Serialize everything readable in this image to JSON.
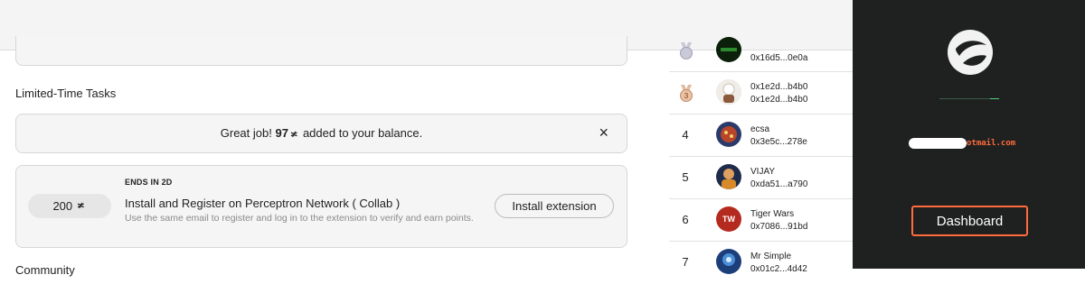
{
  "section": {
    "title": "Limited-Time Tasks",
    "next_title": "Community"
  },
  "toast": {
    "prefix": "Great job!",
    "amount": "97",
    "coin": "≭",
    "suffix": "added to your balance.",
    "close": "×"
  },
  "task": {
    "ends": "ENDS IN 2D",
    "reward": "200",
    "coin": "≭",
    "title": "Install and Register on Perceptron Network ( Collab )",
    "description": "Use the same email to register and log in to the extension to verify and earn points.",
    "button": "Install extension"
  },
  "leaderboard": [
    {
      "rank": "",
      "medal": "bronze-medal-icon",
      "name": "",
      "address": "0x16d5...0e0a",
      "avatar_color": "#1e5b1e"
    },
    {
      "rank": "3",
      "medal": "bronze-medal-icon",
      "name": "0x1e2d...b4b0",
      "address": "0x1e2d...b4b0",
      "avatar_color": "#d6cfc8"
    },
    {
      "rank": "4",
      "name": "ecsa",
      "address": "0x3e5c...278e",
      "avatar_color": "#8a3d2c"
    },
    {
      "rank": "5",
      "name": "VIJAY",
      "address": "0xda51...a790",
      "avatar_color": "#3b4d7a"
    },
    {
      "rank": "6",
      "name": "Tiger Wars",
      "address": "0x7086...91bd",
      "avatar_color": "#b52a1f"
    },
    {
      "rank": "7",
      "name": "Mr Simple",
      "address": "0x01c2...4d42",
      "avatar_color": "#2e6bb0"
    }
  ],
  "panel": {
    "email_suffix": "otmail.com",
    "dashboard": "Dashboard",
    "accent": "#ff6b3d"
  }
}
